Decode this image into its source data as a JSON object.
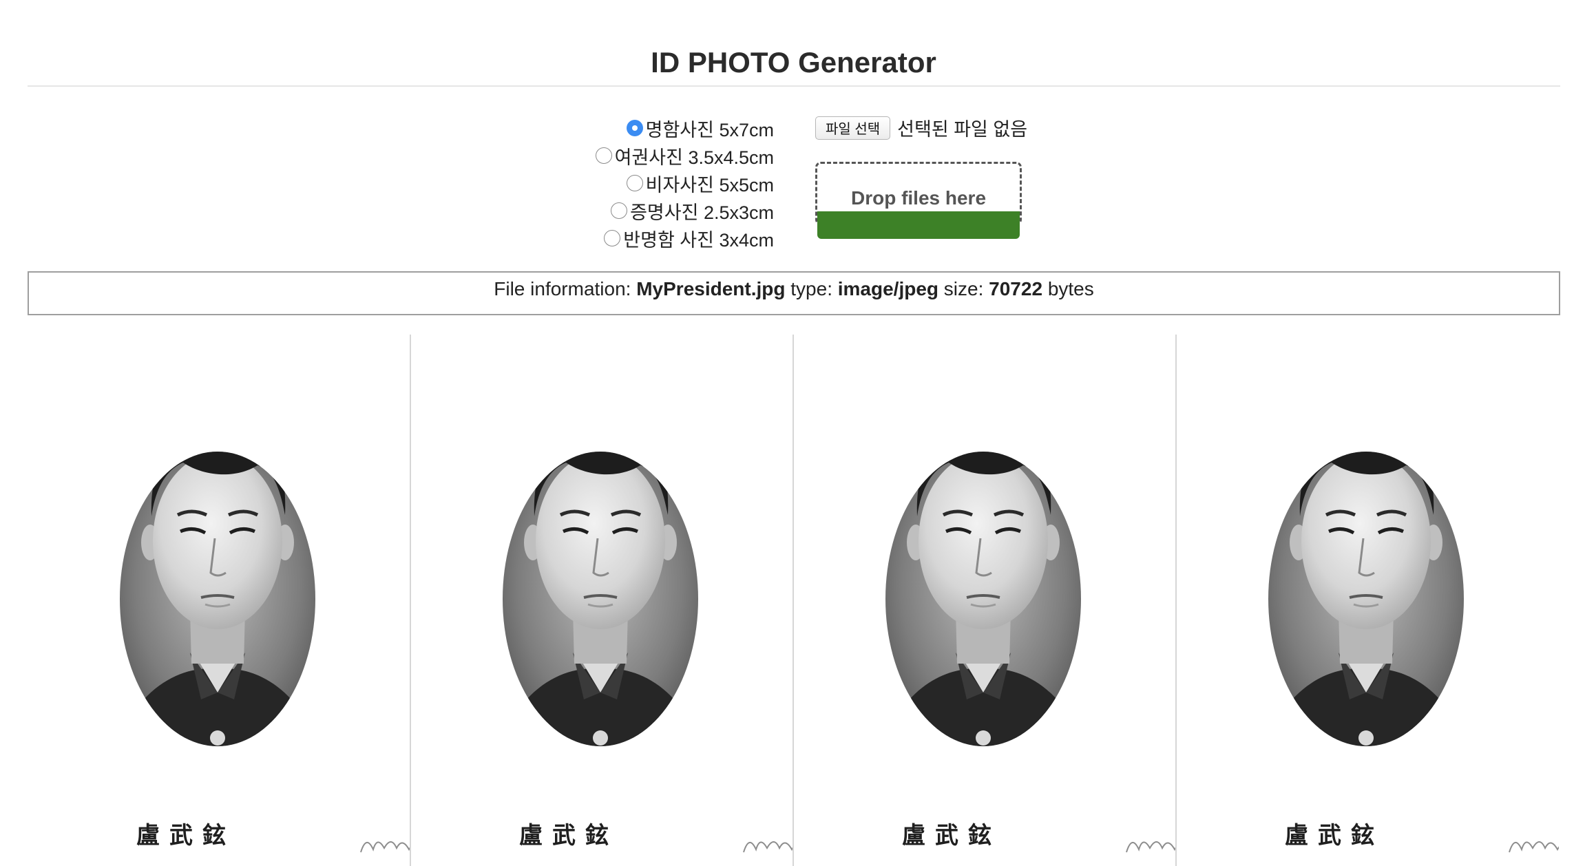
{
  "page": {
    "title": "ID PHOTO Generator"
  },
  "size_options": [
    {
      "label": "명함사진 5x7cm",
      "checked": true
    },
    {
      "label": "여권사진 3.5x4.5cm",
      "checked": false
    },
    {
      "label": "비자사진 5x5cm",
      "checked": false
    },
    {
      "label": "증명사진 2.5x3cm",
      "checked": false
    },
    {
      "label": "반명함 사진 3x4cm",
      "checked": false
    }
  ],
  "file_picker": {
    "button_label": "파일 선택",
    "status": "선택된 파일 없음"
  },
  "drop_zone": {
    "label": "Drop files here",
    "progress": 1.0,
    "progress_color": "#3d8127"
  },
  "file_info": {
    "prefix": "File information:",
    "name": "MyPresident.jpg",
    "type_label": "type:",
    "type": "image/jpeg",
    "size_label": "size:",
    "size": "70722",
    "unit": "bytes"
  },
  "photos": {
    "count": 4,
    "caption": "盧武鉉",
    "style": "black-and-white oval portrait"
  }
}
